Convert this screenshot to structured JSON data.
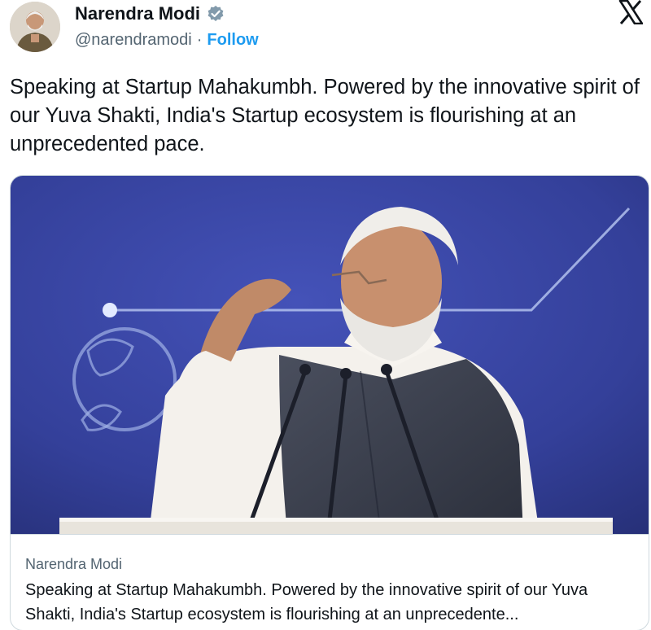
{
  "author": {
    "name": "Narendra Modi",
    "handle": "@narendramodi",
    "separator": "·",
    "follow_label": "Follow"
  },
  "icons": {
    "verified": "verified-badge-icon",
    "platform": "x-logo-icon"
  },
  "tweet": {
    "text": "Speaking at Startup Mahakumbh. Powered by the innovative spirit of our Yuva Shakti, India's Startup ecosystem is flourishing at an unprecedented pace."
  },
  "card": {
    "title": "Narendra Modi",
    "description": "Speaking at Startup Mahakumbh. Powered by the innovative spirit of our Yuva Shakti, India's Startup ecosystem is flourishing at an unprecedente..."
  },
  "colors": {
    "link": "#1d9bf0",
    "secondary_text": "#536471",
    "background_stage": "#3a48a8"
  }
}
